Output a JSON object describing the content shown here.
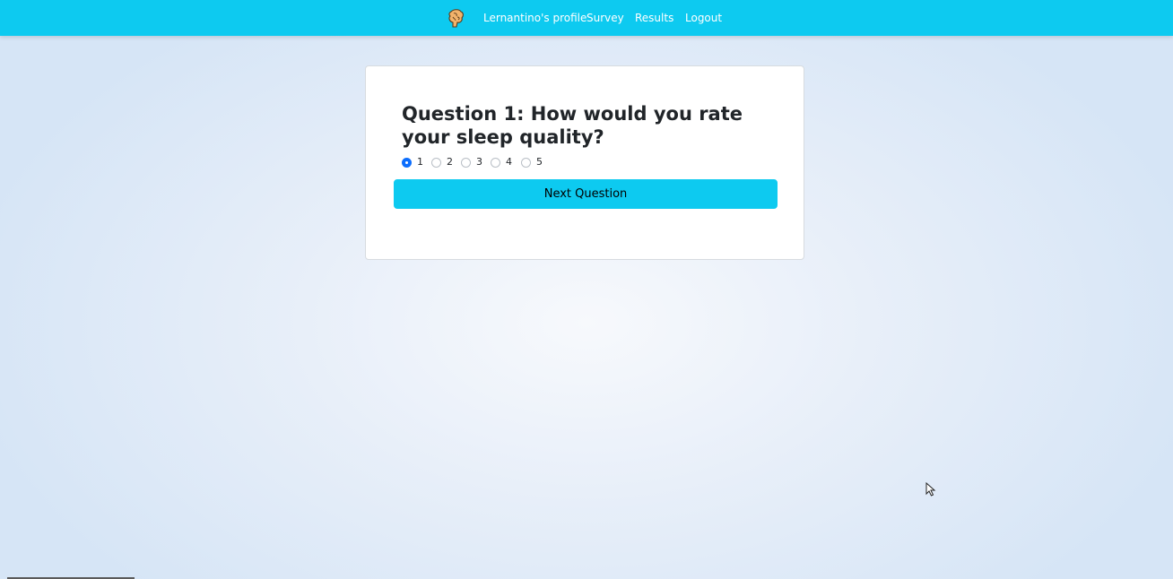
{
  "navbar": {
    "logo_icon": "brain-logo-icon",
    "background_color": "#0dcaf0",
    "links": [
      {
        "label": "Lernantino's profile"
      },
      {
        "label": "Survey"
      },
      {
        "label": "Results"
      },
      {
        "label": "Logout"
      }
    ]
  },
  "survey": {
    "question": "Question 1: How would you rate your sleep quality?",
    "options": [
      "1",
      "2",
      "3",
      "4",
      "5"
    ],
    "selected_option": "1",
    "next_button_label": "Next Question"
  },
  "colors": {
    "accent": "#0dcaf0",
    "radio_selected": "#0d6efd"
  }
}
